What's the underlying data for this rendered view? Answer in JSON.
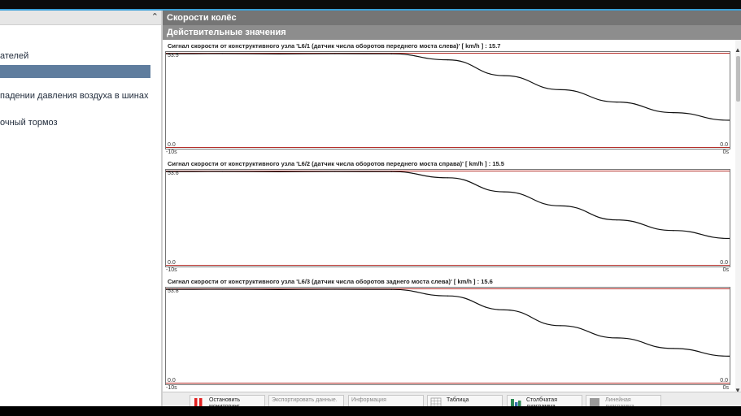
{
  "header": {
    "title": "Скорости колёс",
    "subtitle": "Действительные значения"
  },
  "sidebar": {
    "items": [
      {
        "label": "ателей",
        "selected": false
      },
      {
        "label": "",
        "selected": true
      },
      {
        "label": "падении давления воздуха в шинах",
        "selected": false
      },
      {
        "label": "очный тормоз",
        "selected": false
      }
    ]
  },
  "charts": [
    {
      "title": "Сигнал скорости от конструктивного узла 'L6/1 (датчик числа оборотов переднего моста слева)' [ km/h ] : 15.7",
      "ymax_label": "53.5",
      "ymin_label": "0.0",
      "ymin_right_label": "0.0",
      "xmin_label": "-10s",
      "xmax_label": "0s"
    },
    {
      "title": "Сигнал скорости от конструктивного узла 'L6/2 (датчик числа оборотов переднего моста справа)' [ km/h ] : 15.5",
      "ymax_label": "53.6",
      "ymin_label": "0.0",
      "ymin_right_label": "0.0",
      "xmin_label": "-10s",
      "xmax_label": "0s"
    },
    {
      "title": "Сигнал скорости от конструктивного узла 'L6/3 (датчик числа оборотов заднего моста слева)' [ km/h ] : 15.6",
      "ymax_label": "53.8",
      "ymin_label": "0.0",
      "ymin_right_label": "0.0",
      "xmin_label": "-10s",
      "xmax_label": "0s"
    }
  ],
  "chart_data": [
    {
      "type": "line",
      "x": [
        -10,
        -9,
        -8,
        -7,
        -6,
        -5,
        -4,
        -3,
        -2,
        -1,
        0
      ],
      "series": [
        {
          "values": [
            53.4,
            53.5,
            53.3,
            53.5,
            53.4,
            50,
            41,
            33,
            26,
            20,
            15.7
          ]
        }
      ],
      "ylim": [
        0,
        53.5
      ],
      "xlim": [
        -10,
        0
      ]
    },
    {
      "type": "line",
      "x": [
        -10,
        -9,
        -8,
        -7,
        -6,
        -5,
        -4,
        -3,
        -2,
        -1,
        0
      ],
      "series": [
        {
          "values": [
            53.5,
            53.6,
            53.4,
            53.6,
            53.5,
            50,
            42,
            34,
            26,
            20,
            15.5
          ]
        }
      ],
      "ylim": [
        0,
        53.6
      ],
      "xlim": [
        -10,
        0
      ]
    },
    {
      "type": "line",
      "x": [
        -10,
        -9,
        -8,
        -7,
        -6,
        -5,
        -4,
        -3,
        -2,
        -1,
        0
      ],
      "series": [
        {
          "values": [
            53.7,
            53.8,
            53.6,
            53.8,
            53.7,
            50,
            42,
            33,
            26,
            20,
            15.6
          ]
        }
      ],
      "ylim": [
        0,
        53.8
      ],
      "xlim": [
        -10,
        0
      ]
    }
  ],
  "toolbar": {
    "buttons": [
      {
        "label": "Остановить мониторинг",
        "enabled": true,
        "icon": "stop-icon"
      },
      {
        "label": "Экспортировать данные.",
        "enabled": false,
        "icon": ""
      },
      {
        "label": "Информация",
        "enabled": false,
        "icon": ""
      },
      {
        "label": "Таблица",
        "enabled": true,
        "icon": "table-icon"
      },
      {
        "label": "Столбчатая диаграмма",
        "enabled": true,
        "icon": "bar-chart-icon"
      },
      {
        "label": "Линейная диаграмма",
        "enabled": false,
        "icon": "line-chart-icon"
      }
    ]
  },
  "colors": {
    "header_dark": "#757575",
    "header_light": "#8d8d8d",
    "selection": "#5f7d9e",
    "limit_line": "#b5302b",
    "signal_line": "#111111",
    "stop_red": "#e02020"
  }
}
